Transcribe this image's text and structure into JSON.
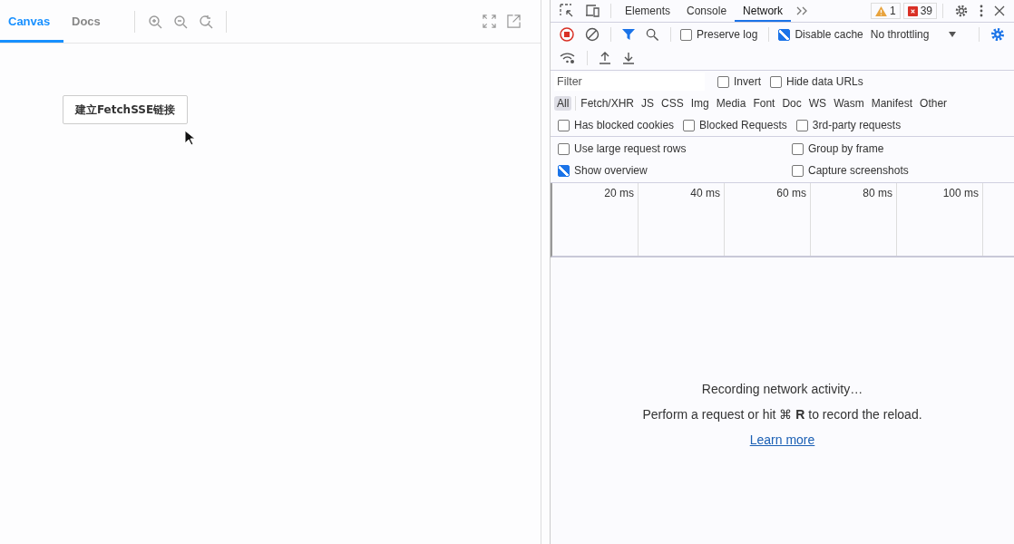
{
  "preview": {
    "tabs": [
      {
        "label": "Canvas",
        "selected": true
      },
      {
        "label": "Docs",
        "selected": false
      }
    ],
    "action_button": "建立FetchSSE链接"
  },
  "devtools": {
    "tabs": [
      {
        "label": "Elements",
        "selected": false
      },
      {
        "label": "Console",
        "selected": false
      },
      {
        "label": "Network",
        "selected": true
      }
    ],
    "warnings": "1",
    "errors": "39",
    "recording": true,
    "preserve_log": {
      "label": "Preserve log",
      "checked": false
    },
    "disable_cache": {
      "label": "Disable cache",
      "checked": true
    },
    "throttling": "No throttling",
    "filter": {
      "placeholder": "Filter"
    },
    "filter_options": [
      {
        "label": "Invert",
        "checked": false
      },
      {
        "label": "Hide data URLs",
        "checked": false
      }
    ],
    "types": [
      {
        "label": "All",
        "selected": true
      },
      {
        "label": "Fetch/XHR",
        "selected": false
      },
      {
        "label": "JS",
        "selected": false
      },
      {
        "label": "CSS",
        "selected": false
      },
      {
        "label": "Img",
        "selected": false
      },
      {
        "label": "Media",
        "selected": false
      },
      {
        "label": "Font",
        "selected": false
      },
      {
        "label": "Doc",
        "selected": false
      },
      {
        "label": "WS",
        "selected": false
      },
      {
        "label": "Wasm",
        "selected": false
      },
      {
        "label": "Manifest",
        "selected": false
      },
      {
        "label": "Other",
        "selected": false
      }
    ],
    "blocked_options": [
      {
        "label": "Has blocked cookies",
        "checked": false
      },
      {
        "label": "Blocked Requests",
        "checked": false
      },
      {
        "label": "3rd-party requests",
        "checked": false
      }
    ],
    "settings": [
      {
        "label": "Use large request rows",
        "checked": false
      },
      {
        "label": "Group by frame",
        "checked": false
      },
      {
        "label": "Show overview",
        "checked": true
      },
      {
        "label": "Capture screenshots",
        "checked": false
      }
    ],
    "overview_ticks": [
      "20 ms",
      "40 ms",
      "60 ms",
      "80 ms",
      "100 ms"
    ],
    "empty_title": "Recording network activity…",
    "empty_hint": "Perform a request or hit ⌘ **R** to record the reload.",
    "learn_more": "Learn more"
  }
}
